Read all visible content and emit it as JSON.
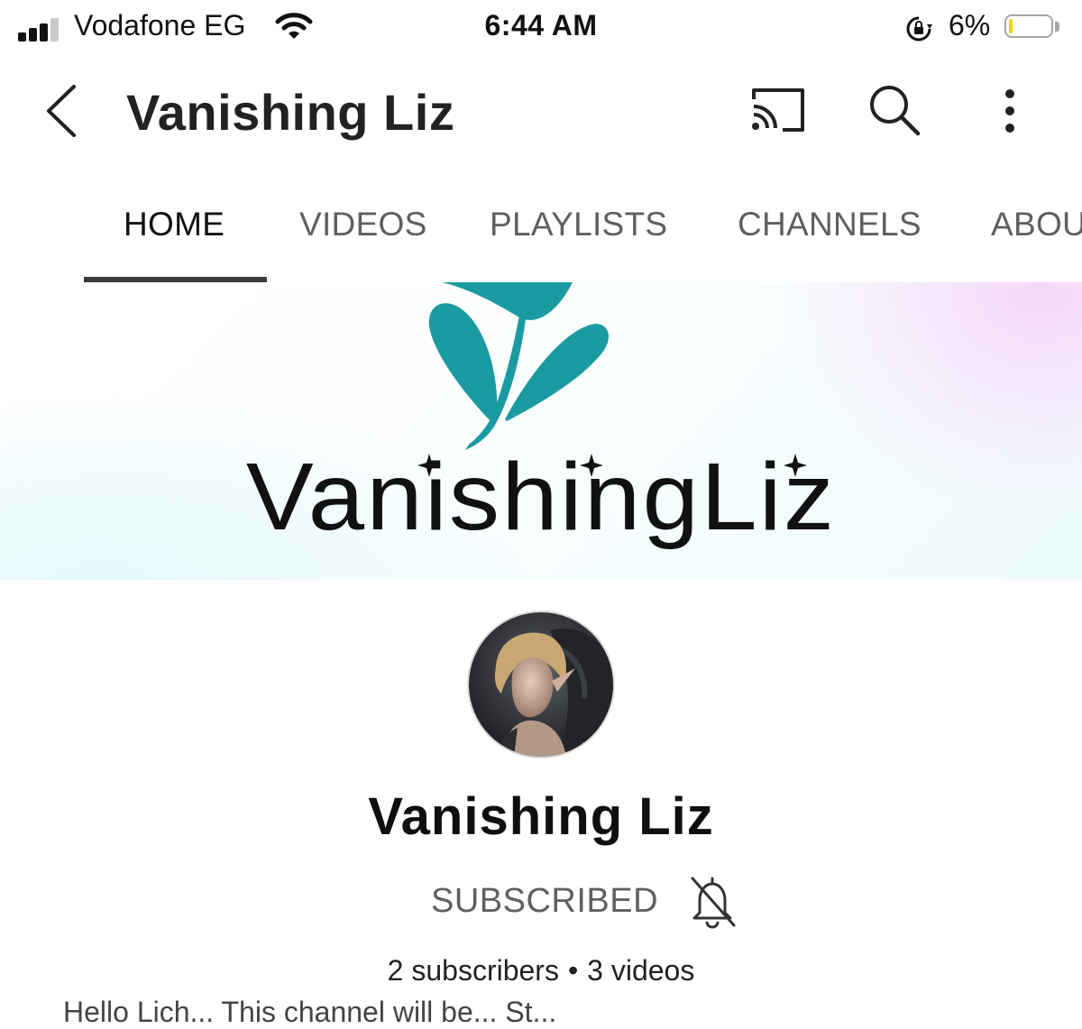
{
  "status_bar": {
    "carrier": "Vodafone EG",
    "time": "6:44 AM",
    "battery_percent": "6%",
    "battery_level": 0.06,
    "signal_bars": 3,
    "icons": [
      "signal-icon",
      "wifi-icon",
      "rotation-lock-icon",
      "battery-icon"
    ]
  },
  "header": {
    "title": "Vanishing Liz",
    "icons": [
      "back-icon",
      "cast-icon",
      "search-icon",
      "more-vert-icon"
    ]
  },
  "tabs": [
    {
      "label": "HOME",
      "active": true
    },
    {
      "label": "VIDEOS",
      "active": false
    },
    {
      "label": "PLAYLISTS",
      "active": false
    },
    {
      "label": "CHANNELS",
      "active": false
    },
    {
      "label": "ABOUT",
      "active": false
    }
  ],
  "banner": {
    "logo_text": "VanishingLiz",
    "leaf_color": "#1a9ba1"
  },
  "channel": {
    "name": "Vanishing Liz",
    "subscribe_label": "SUBSCRIBED",
    "subscribers": "2 subscribers",
    "separator": "•",
    "videos": "3 videos",
    "description": "Hello Lich... This channel will be... St..."
  },
  "colors": {
    "accent_text": "#0f0f0f",
    "secondary_text": "#606060",
    "battery_low": "#f1d500"
  }
}
